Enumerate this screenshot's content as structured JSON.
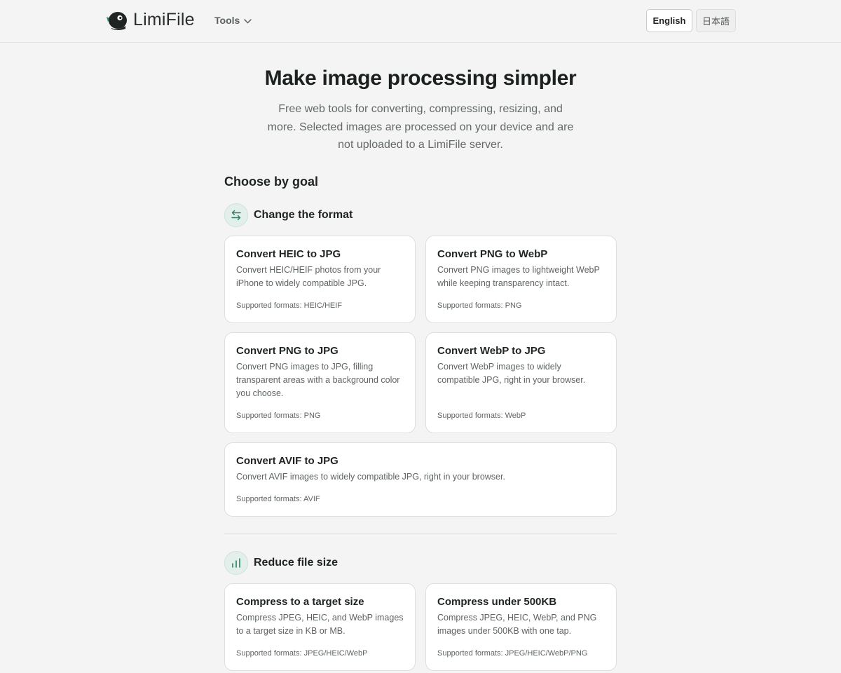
{
  "header": {
    "logo_text": "LimiFile",
    "tools_label": "Tools",
    "lang_english": "English",
    "lang_japanese": "日本語"
  },
  "hero": {
    "title": "Make image processing simpler",
    "description": "Free web tools for converting, compressing, resizing, and more. Selected images are processed on your device and are not uploaded to a LimiFile server."
  },
  "goals": {
    "heading": "Choose by goal"
  },
  "sections": [
    {
      "title": "Change the format",
      "icon": "swap-arrows-icon",
      "cards": [
        {
          "title": "Convert HEIC to JPG",
          "description": "Convert HEIC/HEIF photos from your iPhone to widely compatible JPG.",
          "formats": "Supported formats: HEIC/HEIF"
        },
        {
          "title": "Convert PNG to WebP",
          "description": "Convert PNG images to lightweight WebP while keeping transparency intact.",
          "formats": "Supported formats: PNG"
        },
        {
          "title": "Convert PNG to JPG",
          "description": "Convert PNG images to JPG, filling transparent areas with a background color you choose.",
          "formats": "Supported formats: PNG"
        },
        {
          "title": "Convert WebP to JPG",
          "description": "Convert WebP images to widely compatible JPG, right in your browser.",
          "formats": "Supported formats: WebP"
        },
        {
          "title": "Convert AVIF to JPG",
          "description": "Convert AVIF images to widely compatible JPG, right in your browser.",
          "formats": "Supported formats: AVIF"
        }
      ]
    },
    {
      "title": "Reduce file size",
      "icon": "bar-chart-icon",
      "cards": [
        {
          "title": "Compress to a target size",
          "description": "Compress JPEG, HEIC, and WebP images to a target size in KB or MB.",
          "formats": "Supported formats: JPEG/HEIC/WebP"
        },
        {
          "title": "Compress under 500KB",
          "description": "Compress JPEG, HEIC, WebP, and PNG images under 500KB with one tap.",
          "formats": "Supported formats: JPEG/HEIC/WebP/PNG"
        }
      ]
    }
  ],
  "colors": {
    "page_bg": "#f3f4f3",
    "accent": "#2f7d69",
    "icon_bg": "#e3efea"
  }
}
